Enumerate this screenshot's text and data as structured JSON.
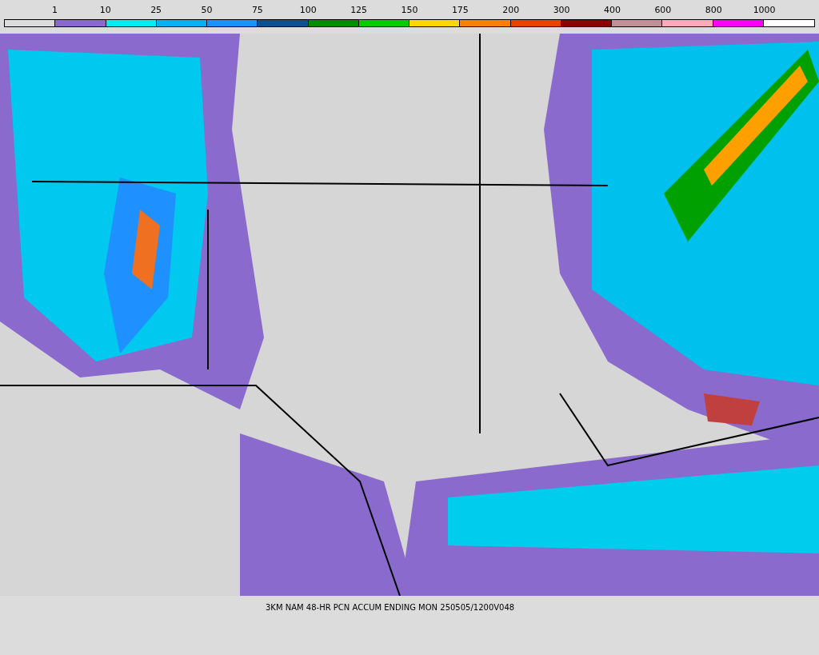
{
  "legend": {
    "swatches": [
      {
        "color": "#dcdcdc"
      },
      {
        "color": "#8a6acc"
      },
      {
        "color": "#00eeee"
      },
      {
        "color": "#00b4ee"
      },
      {
        "color": "#1e90ff"
      },
      {
        "color": "#104e8c"
      },
      {
        "color": "#008b00"
      },
      {
        "color": "#00cd00"
      },
      {
        "color": "#ffd700"
      },
      {
        "color": "#ff7f00"
      },
      {
        "color": "#ee4000"
      },
      {
        "color": "#8b0000"
      },
      {
        "color": "#c09098"
      },
      {
        "color": "#ffaabb"
      },
      {
        "color": "#ff00ff"
      },
      {
        "color": "#ffffff"
      }
    ],
    "labels": [
      "1",
      "10",
      "25",
      "50",
      "75",
      "100",
      "125",
      "150",
      "175",
      "200",
      "300",
      "400",
      "600",
      "800",
      "1000"
    ]
  },
  "caption": "3KM NAM 48-HR PCN ACCUM ENDING MON 250505/1200V048"
}
